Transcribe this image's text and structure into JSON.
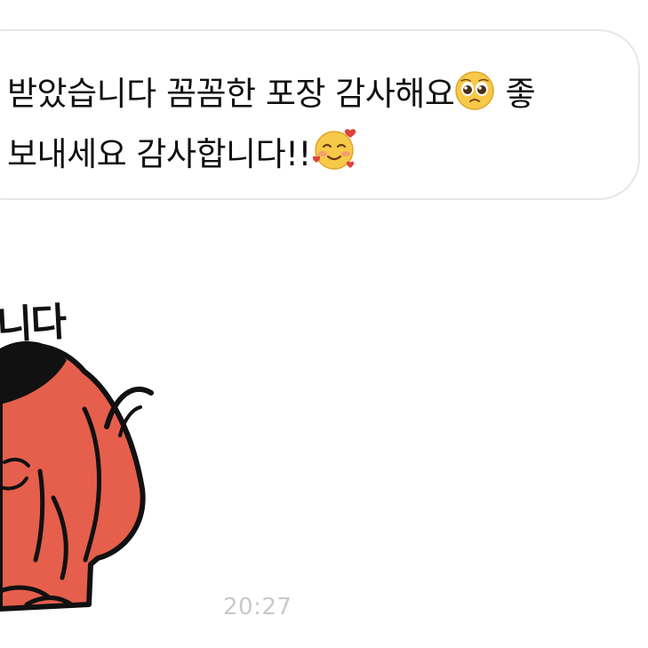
{
  "message": {
    "line1": "받았습니다 꼼꼼한 포장 감사해요",
    "line1_end": " 좋",
    "line2": "보내세요 감사합니다!!",
    "emoji1": "pleading-face-icon",
    "emoji2": "smiling-face-with-hearts-icon"
  },
  "sticker": {
    "text": "니다",
    "color": "#e55f4c"
  },
  "timestamp": "20:27"
}
